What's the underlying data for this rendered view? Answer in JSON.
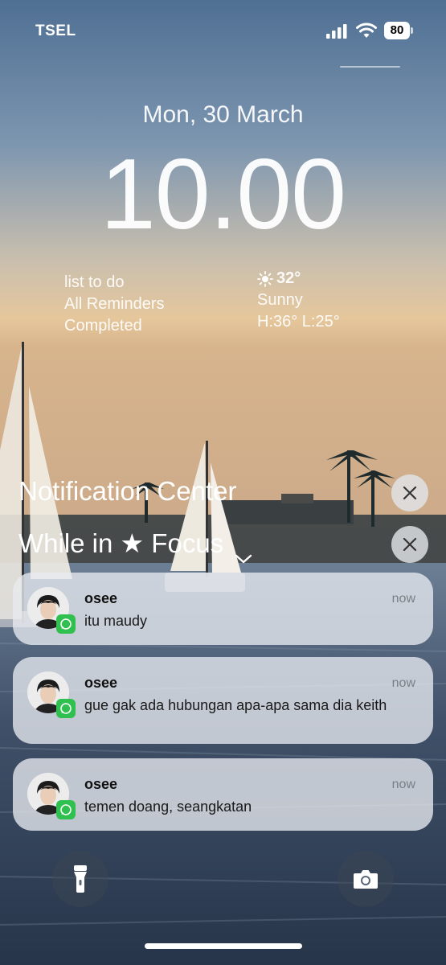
{
  "status_bar": {
    "carrier": "TSEL",
    "battery_level": "80",
    "icons": [
      "cellular-signal-icon",
      "wifi-icon",
      "battery-icon"
    ]
  },
  "lock_screen": {
    "date": "Mon, 30 March",
    "time": "10.00"
  },
  "widgets": {
    "reminders": {
      "title": "list to do",
      "line1": "All Reminders",
      "line2": "Completed"
    },
    "weather": {
      "icon": "sun-icon",
      "temperature": "32°",
      "condition": "Sunny",
      "high_low": "H:36° L:25°"
    }
  },
  "notification_center": {
    "title": "Notification Center",
    "focus_prefix": "While in ",
    "focus_star": "★",
    "focus_label": " Focus",
    "notifications": [
      {
        "app_icon": "whatsapp-icon",
        "sender": "osee",
        "message": "itu maudy",
        "time": "now"
      },
      {
        "app_icon": "whatsapp-icon",
        "sender": "osee",
        "message": "gue gak ada hubungan apa-apa sama dia keith",
        "time": "now"
      },
      {
        "app_icon": "whatsapp-icon",
        "sender": "osee",
        "message": "temen doang, seangkatan",
        "time": "now"
      }
    ]
  },
  "controls": {
    "left": "flashlight-icon",
    "right": "camera-icon"
  },
  "colors": {
    "whatsapp_green": "#30c04f",
    "notification_bg": "#e8ebf0"
  }
}
